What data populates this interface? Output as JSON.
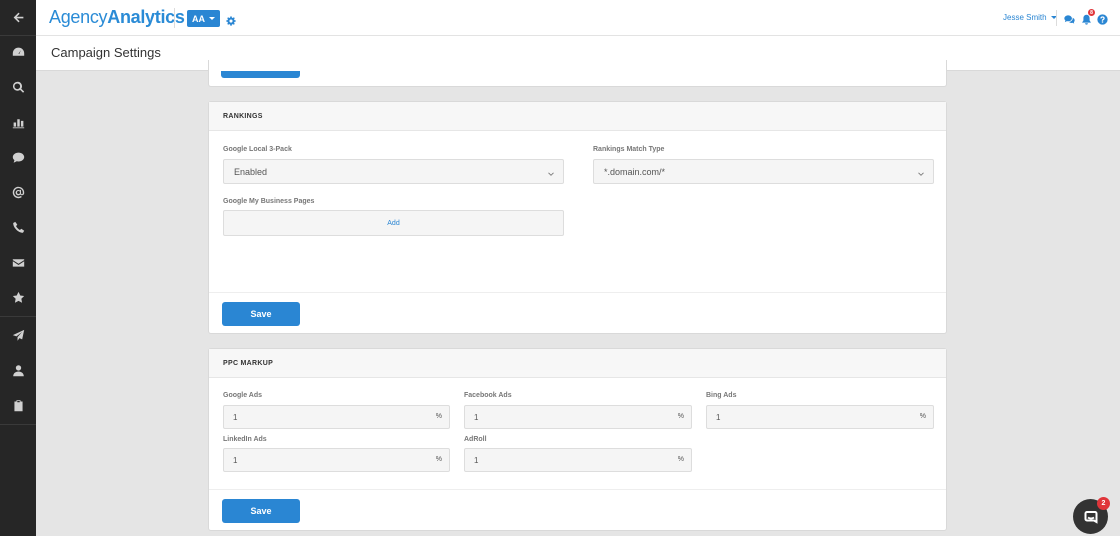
{
  "header": {
    "logo_light": "Agency",
    "logo_bold": "Analytics",
    "account_button": "AA",
    "user_name": "Jesse Smith",
    "notification_count": "8"
  },
  "page": {
    "title": "Campaign Settings"
  },
  "rankings": {
    "heading": "RANKINGS",
    "local_pack_label": "Google Local 3-Pack",
    "local_pack_value": "Enabled",
    "match_type_label": "Rankings Match Type",
    "match_type_value": "*.domain.com/*",
    "gmb_label": "Google My Business Pages",
    "gmb_add": "Add",
    "save_label": "Save"
  },
  "ppc": {
    "heading": "PPC MARKUP",
    "fields": [
      {
        "label": "Google Ads",
        "value": "1",
        "unit": "%"
      },
      {
        "label": "Facebook Ads",
        "value": "1",
        "unit": "%"
      },
      {
        "label": "Bing Ads",
        "value": "1",
        "unit": "%"
      },
      {
        "label": "LinkedIn Ads",
        "value": "1",
        "unit": "%"
      },
      {
        "label": "AdRoll",
        "value": "1",
        "unit": "%"
      }
    ],
    "save_label": "Save"
  },
  "chat": {
    "badge_count": "2"
  },
  "sidebar_icons": [
    "back-arrow-icon",
    "dashboard-icon",
    "search-icon",
    "bar-chart-icon",
    "comment-icon",
    "at-sign-icon",
    "phone-icon",
    "envelope-icon",
    "star-icon",
    "paper-plane-icon",
    "user-icon",
    "clipboard-icon"
  ],
  "colors": {
    "accent": "#2a86d3",
    "sidebar": "#262626",
    "badge": "#e0353a"
  }
}
